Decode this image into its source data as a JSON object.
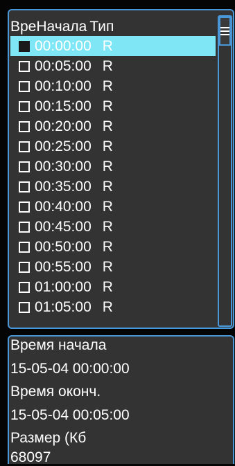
{
  "list": {
    "header": {
      "start_label": "ВреНачала",
      "type_label": "Тип"
    },
    "rows": [
      {
        "time": "00:00:00",
        "type": "R",
        "selected": true
      },
      {
        "time": "00:05:00",
        "type": "R"
      },
      {
        "time": "00:10:00",
        "type": "R"
      },
      {
        "time": "00:15:00",
        "type": "R"
      },
      {
        "time": "00:20:00",
        "type": "R"
      },
      {
        "time": "00:25:00",
        "type": "R"
      },
      {
        "time": "00:30:00",
        "type": "R"
      },
      {
        "time": "00:35:00",
        "type": "R"
      },
      {
        "time": "00:40:00",
        "type": "R"
      },
      {
        "time": "00:45:00",
        "type": "R"
      },
      {
        "time": "00:50:00",
        "type": "R"
      },
      {
        "time": "00:55:00",
        "type": "R"
      },
      {
        "time": "01:00:00",
        "type": "R"
      },
      {
        "time": "01:05:00",
        "type": "R"
      }
    ]
  },
  "info": {
    "start_label": "Время начала",
    "start_value": "15-05-04 00:00:00",
    "end_label": "Время оконч.",
    "end_value": "15-05-04 00:05:00",
    "size_label": "Размер (Кб",
    "size_value": "68097"
  },
  "colors": {
    "accent_border": "#4a97d8",
    "selection": "#7fe6f6",
    "panel_bg": "#333333"
  },
  "icons": {
    "scroll_thumb": "menu-lines-icon"
  }
}
